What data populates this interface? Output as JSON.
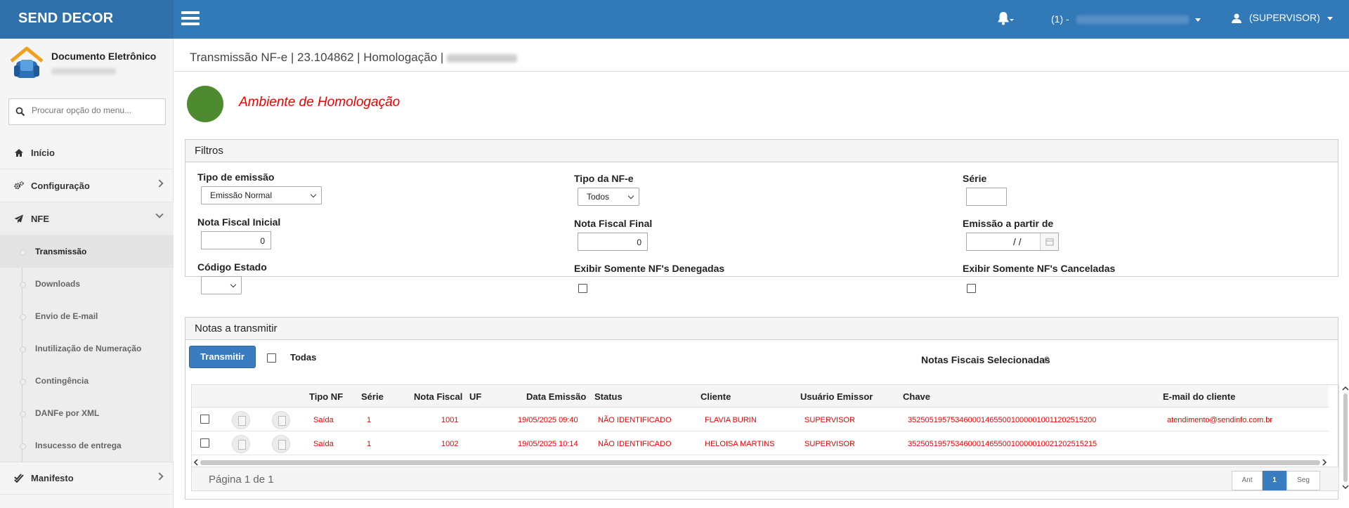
{
  "header": {
    "brand": "SEND DECOR",
    "company_label": "(1) -",
    "user_label": "(SUPERVISOR)"
  },
  "sidebar": {
    "module_title": "Documento Eletrônico",
    "search_placeholder": "Procurar opção do menu...",
    "items": [
      {
        "label": "Início",
        "icon": "home-icon"
      },
      {
        "label": "Configuração",
        "icon": "gears-icon"
      },
      {
        "label": "NFE",
        "icon": "paper-plane-icon"
      }
    ],
    "nfe_submenu": [
      {
        "label": "Transmissão"
      },
      {
        "label": "Downloads"
      },
      {
        "label": "Envio de E-mail"
      },
      {
        "label": "Inutilização de Numeração"
      },
      {
        "label": "Contingência"
      },
      {
        "label": "DANFe por XML"
      },
      {
        "label": "Insucesso de entrega"
      }
    ],
    "manifesto": {
      "label": "Manifesto",
      "icon": "double-check-icon"
    }
  },
  "main": {
    "breadcrumb": "Transmissão NF-e | 23.104862 | Homologação |",
    "environment": "Ambiente de Homologação",
    "env_color": "#4e8a2f",
    "filters": {
      "title": "Filtros",
      "tipo_emissao_label": "Tipo de emissão",
      "tipo_emissao_value": "Emissão Normal",
      "tipo_nfe_label": "Tipo da NF-e",
      "tipo_nfe_value": "Todos",
      "serie_label": "Série",
      "serie_value": "",
      "nota_inicial_label": "Nota Fiscal Inicial",
      "nota_inicial_value": "0",
      "nota_final_label": "Nota Fiscal Final",
      "nota_final_value": "0",
      "emissao_label": "Emissão a partir de",
      "emissao_value": "/ /",
      "codigo_estado_label": "Código Estado",
      "codigo_estado_value": "",
      "denegadas_label": "Exibir Somente NF's Denegadas",
      "canceladas_label": "Exibir Somente NF's Canceladas"
    },
    "notas": {
      "title": "Notas a transmitir",
      "transmit_button": "Transmitir",
      "todas_label": "Todas",
      "selected_label": "Notas Fiscais Selecionadas",
      "selected_count": "0",
      "columns": [
        "Tipo NF",
        "Série",
        "Nota Fiscal",
        "UF",
        "Data Emissão",
        "Status",
        "Cliente",
        "Usuário Emissor",
        "Chave",
        "E-mail do cliente"
      ],
      "rows": [
        {
          "tipo": "Saída",
          "serie": "1",
          "nota": "1001",
          "uf": "",
          "data": "19/05/2025 09:40",
          "status": "NÃO IDENTIFICADO",
          "cliente": "FLAVIA BURIN",
          "usuario": "SUPERVISOR",
          "chave": "35250519575346000146550010000010011202515200",
          "email": "atendimento@sendinfo.com.br"
        },
        {
          "tipo": "Saída",
          "serie": "1",
          "nota": "1002",
          "uf": "",
          "data": "19/05/2025 10:14",
          "status": "NÃO IDENTIFICADO",
          "cliente": "HELOISA MARTINS",
          "usuario": "SUPERVISOR",
          "chave": "35250519575346000146550010000010021202515215",
          "email": ""
        }
      ],
      "page_text": "Página 1 de 1",
      "pager": {
        "prev": "Ant",
        "current": "1",
        "next": "Seg"
      }
    }
  }
}
